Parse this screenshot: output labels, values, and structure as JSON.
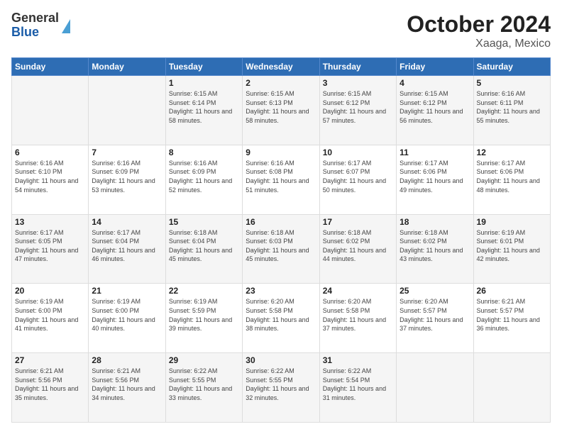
{
  "header": {
    "logo_line1": "General",
    "logo_line2": "Blue",
    "title": "October 2024",
    "subtitle": "Xaaga, Mexico"
  },
  "columns": [
    "Sunday",
    "Monday",
    "Tuesday",
    "Wednesday",
    "Thursday",
    "Friday",
    "Saturday"
  ],
  "weeks": [
    [
      {
        "day": "",
        "text": ""
      },
      {
        "day": "",
        "text": ""
      },
      {
        "day": "1",
        "text": "Sunrise: 6:15 AM\nSunset: 6:14 PM\nDaylight: 11 hours and 58 minutes."
      },
      {
        "day": "2",
        "text": "Sunrise: 6:15 AM\nSunset: 6:13 PM\nDaylight: 11 hours and 58 minutes."
      },
      {
        "day": "3",
        "text": "Sunrise: 6:15 AM\nSunset: 6:12 PM\nDaylight: 11 hours and 57 minutes."
      },
      {
        "day": "4",
        "text": "Sunrise: 6:15 AM\nSunset: 6:12 PM\nDaylight: 11 hours and 56 minutes."
      },
      {
        "day": "5",
        "text": "Sunrise: 6:16 AM\nSunset: 6:11 PM\nDaylight: 11 hours and 55 minutes."
      }
    ],
    [
      {
        "day": "6",
        "text": "Sunrise: 6:16 AM\nSunset: 6:10 PM\nDaylight: 11 hours and 54 minutes."
      },
      {
        "day": "7",
        "text": "Sunrise: 6:16 AM\nSunset: 6:09 PM\nDaylight: 11 hours and 53 minutes."
      },
      {
        "day": "8",
        "text": "Sunrise: 6:16 AM\nSunset: 6:09 PM\nDaylight: 11 hours and 52 minutes."
      },
      {
        "day": "9",
        "text": "Sunrise: 6:16 AM\nSunset: 6:08 PM\nDaylight: 11 hours and 51 minutes."
      },
      {
        "day": "10",
        "text": "Sunrise: 6:17 AM\nSunset: 6:07 PM\nDaylight: 11 hours and 50 minutes."
      },
      {
        "day": "11",
        "text": "Sunrise: 6:17 AM\nSunset: 6:06 PM\nDaylight: 11 hours and 49 minutes."
      },
      {
        "day": "12",
        "text": "Sunrise: 6:17 AM\nSunset: 6:06 PM\nDaylight: 11 hours and 48 minutes."
      }
    ],
    [
      {
        "day": "13",
        "text": "Sunrise: 6:17 AM\nSunset: 6:05 PM\nDaylight: 11 hours and 47 minutes."
      },
      {
        "day": "14",
        "text": "Sunrise: 6:17 AM\nSunset: 6:04 PM\nDaylight: 11 hours and 46 minutes."
      },
      {
        "day": "15",
        "text": "Sunrise: 6:18 AM\nSunset: 6:04 PM\nDaylight: 11 hours and 45 minutes."
      },
      {
        "day": "16",
        "text": "Sunrise: 6:18 AM\nSunset: 6:03 PM\nDaylight: 11 hours and 45 minutes."
      },
      {
        "day": "17",
        "text": "Sunrise: 6:18 AM\nSunset: 6:02 PM\nDaylight: 11 hours and 44 minutes."
      },
      {
        "day": "18",
        "text": "Sunrise: 6:18 AM\nSunset: 6:02 PM\nDaylight: 11 hours and 43 minutes."
      },
      {
        "day": "19",
        "text": "Sunrise: 6:19 AM\nSunset: 6:01 PM\nDaylight: 11 hours and 42 minutes."
      }
    ],
    [
      {
        "day": "20",
        "text": "Sunrise: 6:19 AM\nSunset: 6:00 PM\nDaylight: 11 hours and 41 minutes."
      },
      {
        "day": "21",
        "text": "Sunrise: 6:19 AM\nSunset: 6:00 PM\nDaylight: 11 hours and 40 minutes."
      },
      {
        "day": "22",
        "text": "Sunrise: 6:19 AM\nSunset: 5:59 PM\nDaylight: 11 hours and 39 minutes."
      },
      {
        "day": "23",
        "text": "Sunrise: 6:20 AM\nSunset: 5:58 PM\nDaylight: 11 hours and 38 minutes."
      },
      {
        "day": "24",
        "text": "Sunrise: 6:20 AM\nSunset: 5:58 PM\nDaylight: 11 hours and 37 minutes."
      },
      {
        "day": "25",
        "text": "Sunrise: 6:20 AM\nSunset: 5:57 PM\nDaylight: 11 hours and 37 minutes."
      },
      {
        "day": "26",
        "text": "Sunrise: 6:21 AM\nSunset: 5:57 PM\nDaylight: 11 hours and 36 minutes."
      }
    ],
    [
      {
        "day": "27",
        "text": "Sunrise: 6:21 AM\nSunset: 5:56 PM\nDaylight: 11 hours and 35 minutes."
      },
      {
        "day": "28",
        "text": "Sunrise: 6:21 AM\nSunset: 5:56 PM\nDaylight: 11 hours and 34 minutes."
      },
      {
        "day": "29",
        "text": "Sunrise: 6:22 AM\nSunset: 5:55 PM\nDaylight: 11 hours and 33 minutes."
      },
      {
        "day": "30",
        "text": "Sunrise: 6:22 AM\nSunset: 5:55 PM\nDaylight: 11 hours and 32 minutes."
      },
      {
        "day": "31",
        "text": "Sunrise: 6:22 AM\nSunset: 5:54 PM\nDaylight: 11 hours and 31 minutes."
      },
      {
        "day": "",
        "text": ""
      },
      {
        "day": "",
        "text": ""
      }
    ]
  ]
}
